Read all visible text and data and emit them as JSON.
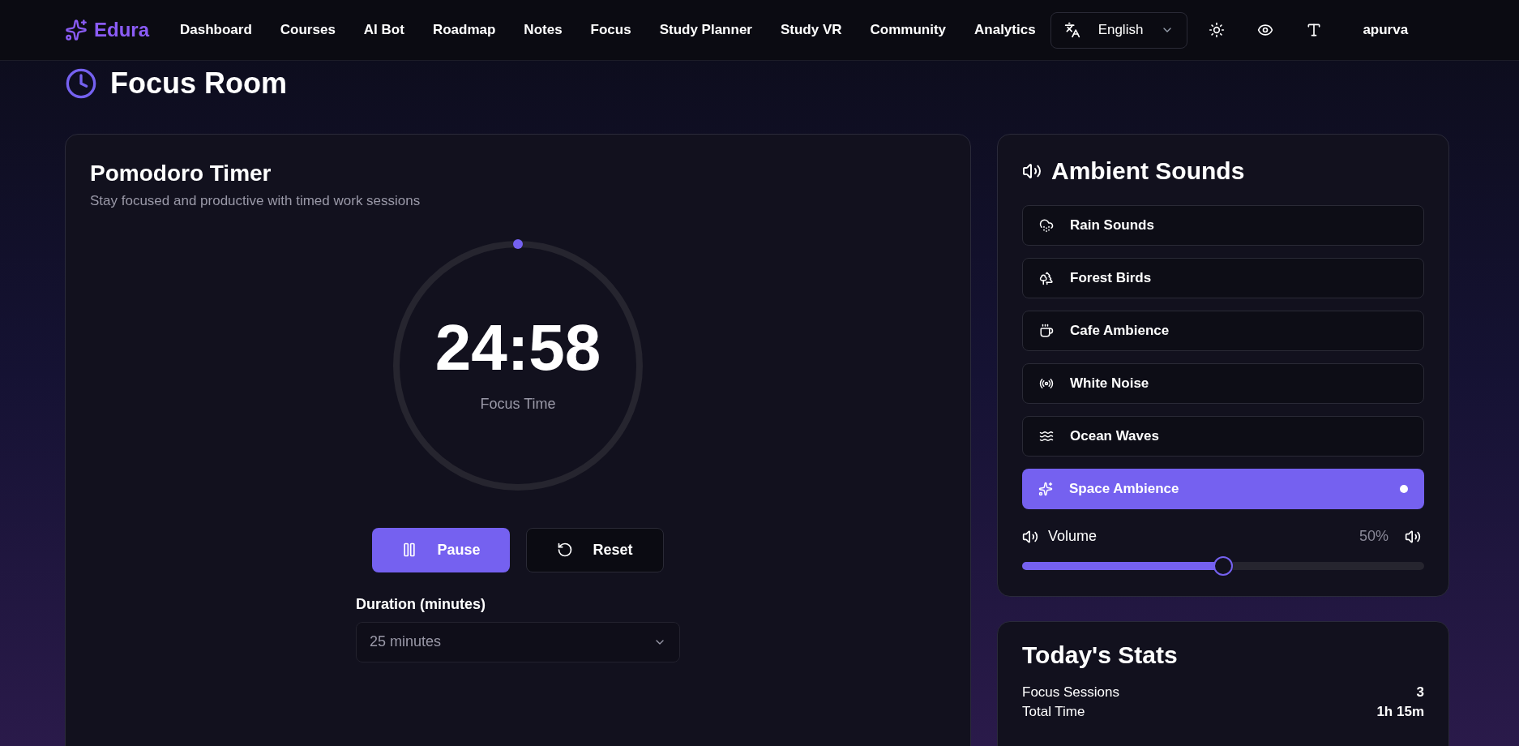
{
  "brand": "Edura",
  "nav": [
    {
      "label": "Dashboard"
    },
    {
      "label": "Courses"
    },
    {
      "label": "AI Bot"
    },
    {
      "label": "Roadmap"
    },
    {
      "label": "Notes"
    },
    {
      "label": "Focus"
    },
    {
      "label": "Study Planner"
    },
    {
      "label": "Study VR"
    },
    {
      "label": "Community"
    },
    {
      "label": "Analytics"
    }
  ],
  "language": "English",
  "user": "apurva",
  "page_title": "Focus Room",
  "timer": {
    "title": "Pomodoro Timer",
    "subtitle": "Stay focused and productive with timed work sessions",
    "time": "24:58",
    "mode": "Focus Time",
    "buttons": [
      {
        "kind": "pause",
        "label": "Pause"
      },
      {
        "kind": "reset",
        "label": "Reset"
      }
    ],
    "duration_label": "Duration (minutes)",
    "duration_value": "25 minutes"
  },
  "sounds": {
    "title": "Ambient Sounds",
    "items": [
      {
        "kind": "rain",
        "label": "Rain Sounds",
        "selected": false
      },
      {
        "kind": "forest",
        "label": "Forest Birds",
        "selected": false
      },
      {
        "kind": "cafe",
        "label": "Cafe Ambience",
        "selected": false
      },
      {
        "kind": "noise",
        "label": "White Noise",
        "selected": false
      },
      {
        "kind": "ocean",
        "label": "Ocean Waves",
        "selected": false
      },
      {
        "kind": "space",
        "label": "Space Ambience",
        "selected": true
      }
    ],
    "volume_label": "Volume",
    "volume_reading": "50%",
    "level": 0.5
  },
  "stats": {
    "title": "Today's Stats",
    "rows": [
      {
        "label": "Focus Sessions",
        "value": "3"
      },
      {
        "label": "Total Time",
        "value": "1h 15m"
      }
    ]
  }
}
